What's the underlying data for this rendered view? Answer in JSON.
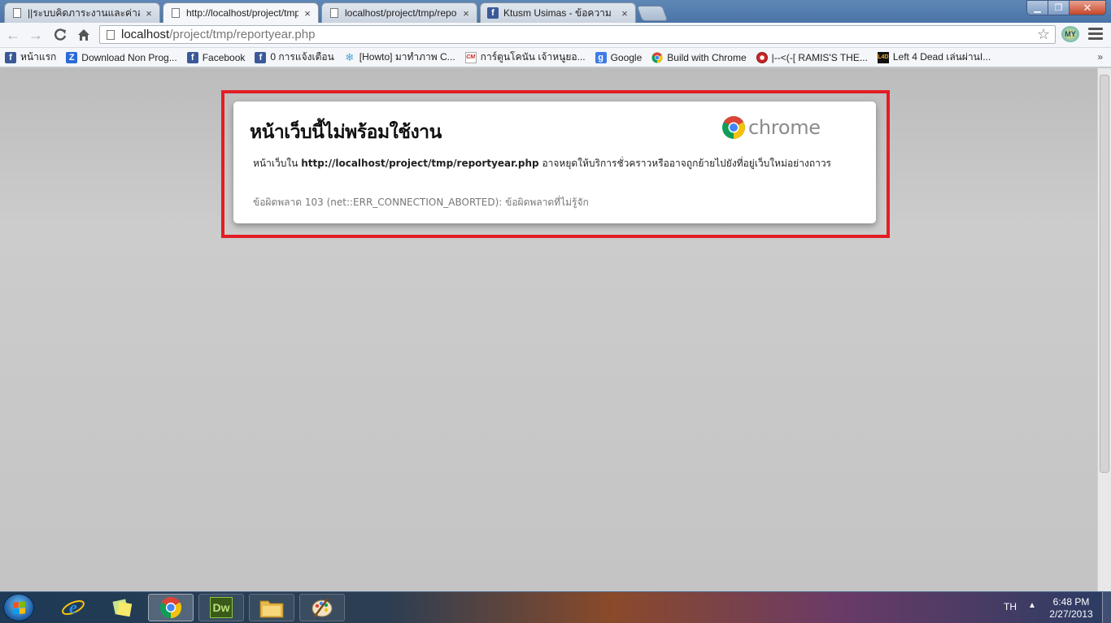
{
  "tabs": [
    {
      "title": "||ระบบคิดภาระงานและค่าสอน",
      "icon": "page",
      "active": false
    },
    {
      "title": "http://localhost/project/tmp",
      "icon": "page",
      "active": true
    },
    {
      "title": "localhost/project/tmp/repo",
      "icon": "page",
      "active": false
    },
    {
      "title": "Ktusm Usimas - ข้อความ",
      "icon": "facebook",
      "active": false
    }
  ],
  "tab_close_glyph": "×",
  "window": {
    "minimize": "▁",
    "maximize": "❐",
    "close": "✕"
  },
  "address": {
    "host": "localhost",
    "path": "/project/tmp/reportyear.php"
  },
  "extension_label": "MY",
  "bookmarks": [
    {
      "label": "หน้าแรก",
      "icon": "facebook"
    },
    {
      "label": "Download Non Prog...",
      "icon": "z"
    },
    {
      "label": "Facebook",
      "icon": "facebook"
    },
    {
      "label": "0 การแจ้งเตือน",
      "icon": "facebook"
    },
    {
      "label": "[Howto] มาทำภาพ C...",
      "icon": "snowflake"
    },
    {
      "label": "การ์ตูนโคนัน เจ้าหนูยอ...",
      "icon": "cm"
    },
    {
      "label": "Google",
      "icon": "google"
    },
    {
      "label": "Build with Chrome",
      "icon": "chrome"
    },
    {
      "label": "|--<(-[ RAMIS'S THE...",
      "icon": "ramis"
    },
    {
      "label": "Left 4 Dead เล่นผ่านI...",
      "icon": "l4d"
    }
  ],
  "bookmarks_more": "»",
  "error": {
    "title": "หน้าเว็บนี้ไม่พร้อมใช้งาน",
    "brand": "chrome",
    "message_prefix": "หน้าเว็บใน ",
    "message_url": "http://localhost/project/tmp/reportyear.php",
    "message_suffix": " อาจหยุดให้บริการชั่วคราวหรืออาจถูกย้ายไปยังที่อยู่เว็บใหม่อย่างถาวร",
    "code": "ข้อผิดพลาด 103 (net::ERR_CONNECTION_ABORTED): ข้อผิดพลาดที่ไม่รู้จัก"
  },
  "taskbar": {
    "items": [
      "internet-explorer",
      "sticky-notes",
      "google-chrome",
      "dreamweaver",
      "windows-explorer",
      "paint"
    ],
    "dreamweaver_label": "Dw",
    "language": "TH",
    "tray_arrow": "▲",
    "time": "6:48 PM",
    "date": "2/27/2013"
  },
  "colors": {
    "highlight_border": "#e31e24",
    "facebook_blue": "#3b5998",
    "chrome_red": "#db4437",
    "chrome_yellow": "#f4c20d",
    "chrome_green": "#0f9d58",
    "chrome_blue": "#4285f4"
  }
}
